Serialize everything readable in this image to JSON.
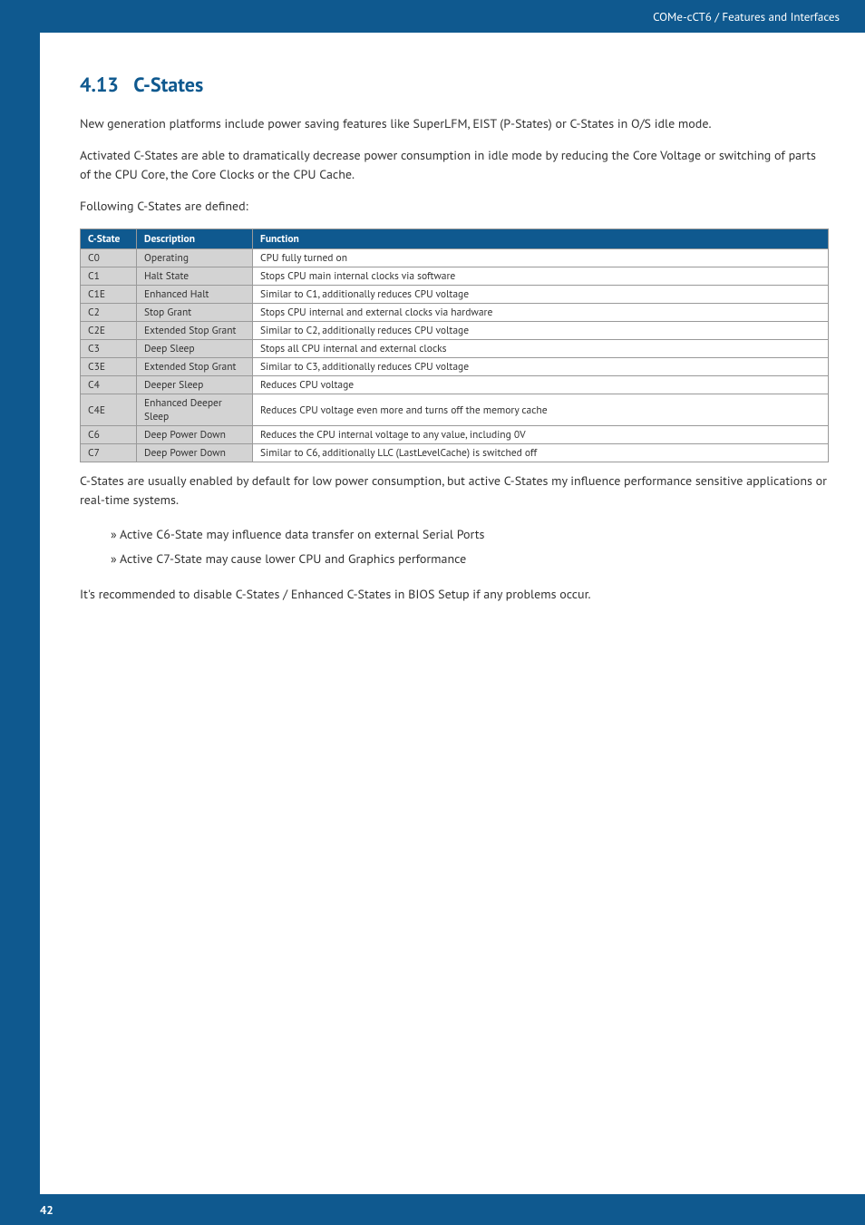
{
  "header": {
    "breadcrumb": "COMe-cCT6 / Features and Interfaces"
  },
  "section": {
    "number": "4.13",
    "title": "C-States",
    "p1": "New generation platforms include power saving features like SuperLFM, EIST (P-States) or C-States in O/S idle mode.",
    "p2": "Activated C-States are able to dramatically decrease power consumption in idle mode by reducing the Core Voltage or switching of parts of the CPU Core, the Core Clocks or the CPU Cache.",
    "p3": "Following C-States are defined:",
    "p4": "C-States are usually enabled by default for low power consumption, but active C-States my influence performance sensitive applications or real-time systems.",
    "p5": "It's recommended to disable C-States / Enhanced C-States in BIOS Setup if any problems occur."
  },
  "table": {
    "headers": {
      "c1": "C-State",
      "c2": "Description",
      "c3": "Function"
    },
    "rows": [
      {
        "state": "C0",
        "desc": "Operating",
        "func": "CPU fully turned on"
      },
      {
        "state": "C1",
        "desc": "Halt State",
        "func": "Stops CPU main internal clocks via software"
      },
      {
        "state": "C1E",
        "desc": "Enhanced Halt",
        "func": "Similar to C1, additionally reduces CPU voltage"
      },
      {
        "state": "C2",
        "desc": "Stop Grant",
        "func": "Stops CPU internal and external clocks via hardware"
      },
      {
        "state": "C2E",
        "desc": "Extended Stop Grant",
        "func": "Similar to C2, additionally reduces CPU voltage"
      },
      {
        "state": "C3",
        "desc": "Deep Sleep",
        "func": "Stops all CPU internal and external clocks"
      },
      {
        "state": "C3E",
        "desc": "Extended Stop Grant",
        "func": "Similar to C3, additionally reduces CPU voltage"
      },
      {
        "state": "C4",
        "desc": "Deeper Sleep",
        "func": "Reduces CPU voltage"
      },
      {
        "state": "C4E",
        "desc": "Enhanced Deeper Sleep",
        "func": "Reduces CPU voltage even more and turns off the memory cache"
      },
      {
        "state": "C6",
        "desc": "Deep Power Down",
        "func": "Reduces the CPU internal voltage to any value, including 0V"
      },
      {
        "state": "C7",
        "desc": "Deep Power Down",
        "func": "Similar to C6, additionally LLC (LastLevelCache) is switched off"
      }
    ]
  },
  "bullets": {
    "b1": "Active C6-State may influence data transfer on external Serial Ports",
    "b2": "Active C7-State may cause lower CPU and Graphics performance"
  },
  "footer": {
    "page": "42"
  }
}
